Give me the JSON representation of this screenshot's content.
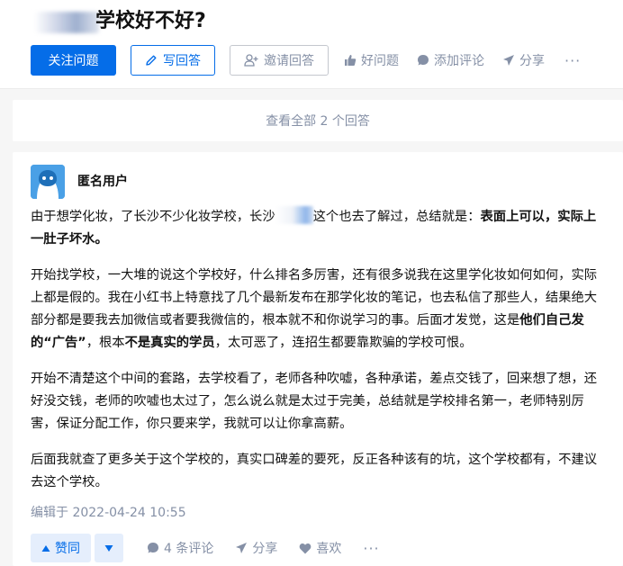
{
  "question": {
    "title": "学校好不好?"
  },
  "question_actions": {
    "follow_label": "关注问题",
    "write_label": "写回答",
    "invite_label": "邀请回答",
    "good_question_label": "好问题",
    "comment_label": "添加评论",
    "share_label": "分享",
    "more_label": "···"
  },
  "view_all": {
    "label": "查看全部 2 个回答"
  },
  "answer": {
    "author": "匿名用户",
    "p1": {
      "a": "由于想学化妆，了长沙不少化妆学校，长沙",
      "b": "这个也去了解过，总结就是：",
      "c": "表面上可以，实际上一肚子坏水。"
    },
    "p2": {
      "a": "开始找学校，一大堆的说这个学校好，什么排名多厉害，还有很多说我在这里学化妆如何如何，实际上都是假的。我在小红书上特意找了几个最新发布在那学化妆的笔记，也去私信了那些人，结果绝大部分都是要我去加微信或者要我微信的，根本就不和你说学习的事。后面才发觉，这是",
      "b": "他们自己发的“广告”",
      "c": "，根本",
      "d": "不是真实的学员",
      "e": "，太可恶了，连招生都要靠欺骗的学校可恨。"
    },
    "p3": "开始不清楚这个中间的套路，去学校看了，老师各种吹嘘，各种承诺，差点交钱了，回来想了想，还好没交钱，老师的吹嘘也太过了，怎么说么就是太过于完美，总结就是学校排名第一，老师特别厉害，保证分配工作，你只要来学，我就可以让你拿高薪。",
    "p4": "后面我就查了更多关于这个学校的，真实口碑差的要死，反正各种该有的坑，这个学校都有，不建议去这个学校。",
    "edited": "编辑于 2022-04-24 10:55",
    "upvote_label": "赞同",
    "comments_label": "4 条评论",
    "share_label": "分享",
    "like_label": "喜欢",
    "more_label": "···"
  },
  "colors": {
    "brand": "#056de8",
    "muted": "#8590a6",
    "vote_bg": "#e5eefc",
    "page_bg": "#f6f6f6"
  },
  "icons": [
    "pen-icon",
    "invite-user-icon",
    "thumbs-up-icon",
    "comment-icon",
    "share-plane-icon",
    "heart-icon",
    "triangle-up-icon",
    "triangle-down-icon"
  ]
}
